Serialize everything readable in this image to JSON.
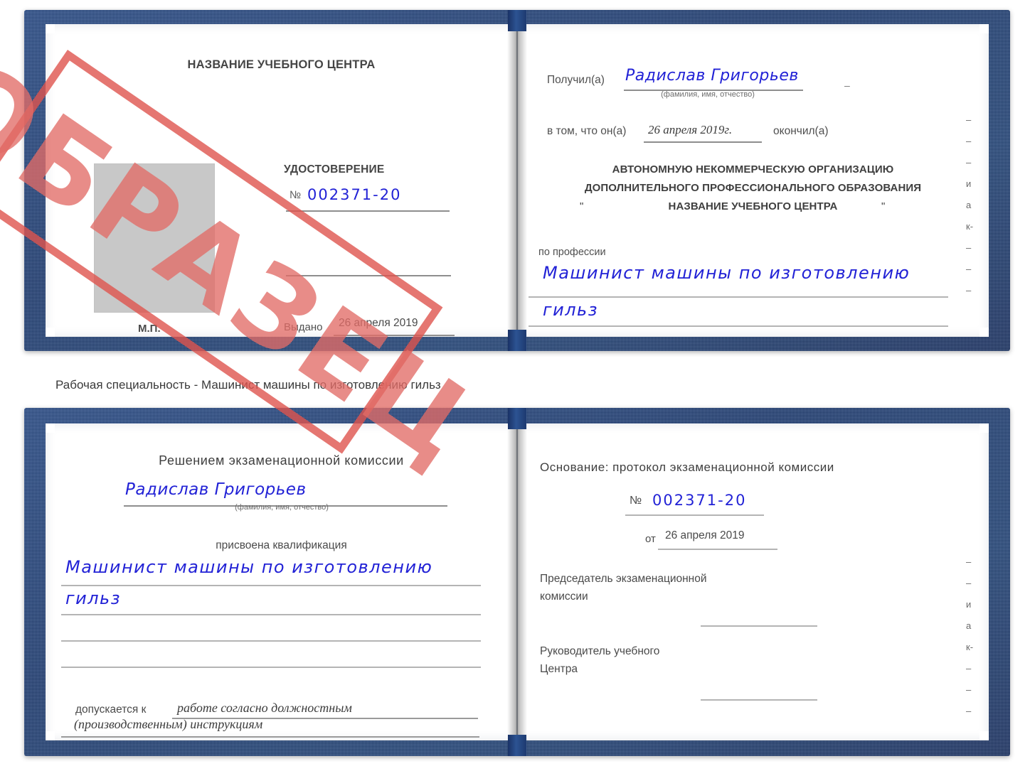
{
  "document": {
    "type": "certificate-spread",
    "caption": "Рабочая специальность - Машинист машины по изготовлению гильз",
    "stamp_label": "ОБРАЗЕЦ",
    "colors": {
      "cover_blue": "#24487f",
      "stamp_red": "#e26c66",
      "ink_blue": "#2222d6",
      "text_grey": "#4a4a4a",
      "photo_placeholder": "#c8c8c8"
    }
  },
  "top_book": {
    "left_page": {
      "header": "НАЗВАНИЕ УЧЕБНОГО ЦЕНТРА",
      "doc_title": "УДОСТОВЕРЕНИЕ",
      "number_prefix": "№",
      "number_value": "002371-20",
      "issued_label": "Выдано",
      "issued_value": "26 апреля 2019",
      "seal_label": "М.П.",
      "photo_alt": "фото"
    },
    "right_page": {
      "received_label": "Получил(а)",
      "received_value": "Радислав Григорьев",
      "name_hint": "(фамилия, имя, отчество)",
      "in_that_label": "в том, что он(а)",
      "in_that_value": "26 апреля 2019г.",
      "finished_label": "окончил(а)",
      "org_line_1": "АВТОНОМНУЮ НЕКОММЕРЧЕСКУЮ ОРГАНИЗАЦИЮ",
      "org_line_2": "ДОПОЛНИТЕЛЬНОГО ПРОФЕССИОНАЛЬНОГО ОБРАЗОВАНИЯ",
      "org_quote_open": "\"",
      "org_line_3": "НАЗВАНИЕ УЧЕБНОГО ЦЕНТРА",
      "org_quote_close": "\"",
      "profession_label": "по профессии",
      "profession_value_line_1": "Машинист машины по изготовлению",
      "profession_value_line_2": "гильз",
      "edge_marks": [
        "–",
        "–",
        "–",
        "и",
        "а",
        "к-",
        "–",
        "–",
        "–"
      ]
    }
  },
  "bottom_book": {
    "left_page": {
      "heading": "Решением экзаменационной комиссии",
      "name_value": "Радислав Григорьев",
      "name_hint": "(фамилия, имя, отчество)",
      "qualification_label": "присвоена квалификация",
      "qualification_value_line_1": "Машинист машины по изготовлению",
      "qualification_value_line_2": "гильз",
      "admitted_label": "допускается к",
      "admitted_value_line_1": "работе согласно должностным",
      "admitted_value_line_2": "(производственным) инструкциям"
    },
    "right_page": {
      "basis_label": "Основание: протокол экзаменационной комиссии",
      "number_prefix": "№",
      "number_value": "002371-20",
      "date_prefix": "от",
      "date_value": "26 апреля 2019",
      "chairman_line_1": "Председатель экзаменационной",
      "chairman_line_2": "комиссии",
      "head_line_1": "Руководитель учебного",
      "head_line_2": "Центра",
      "edge_marks": [
        "–",
        "–",
        "и",
        "а",
        "к-",
        "–",
        "–",
        "–"
      ]
    }
  }
}
